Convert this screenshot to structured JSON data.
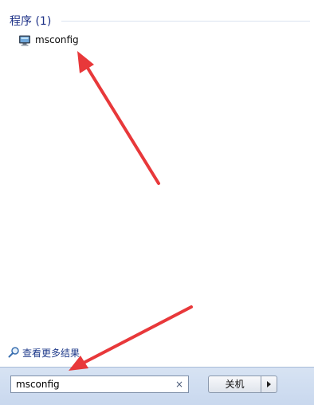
{
  "results": {
    "group_title": "程序 (1)",
    "items": [
      {
        "label": "msconfig",
        "icon": "msconfig-app-icon"
      }
    ],
    "see_more_label": "查看更多结果",
    "see_more_icon": "magnifier-icon"
  },
  "search": {
    "value": "msconfig",
    "clear_icon": "×"
  },
  "power": {
    "shutdown_label": "关机",
    "arrow_icon": "chevron-right-icon"
  },
  "annotations": {
    "arrow_color": "#e8383a"
  }
}
